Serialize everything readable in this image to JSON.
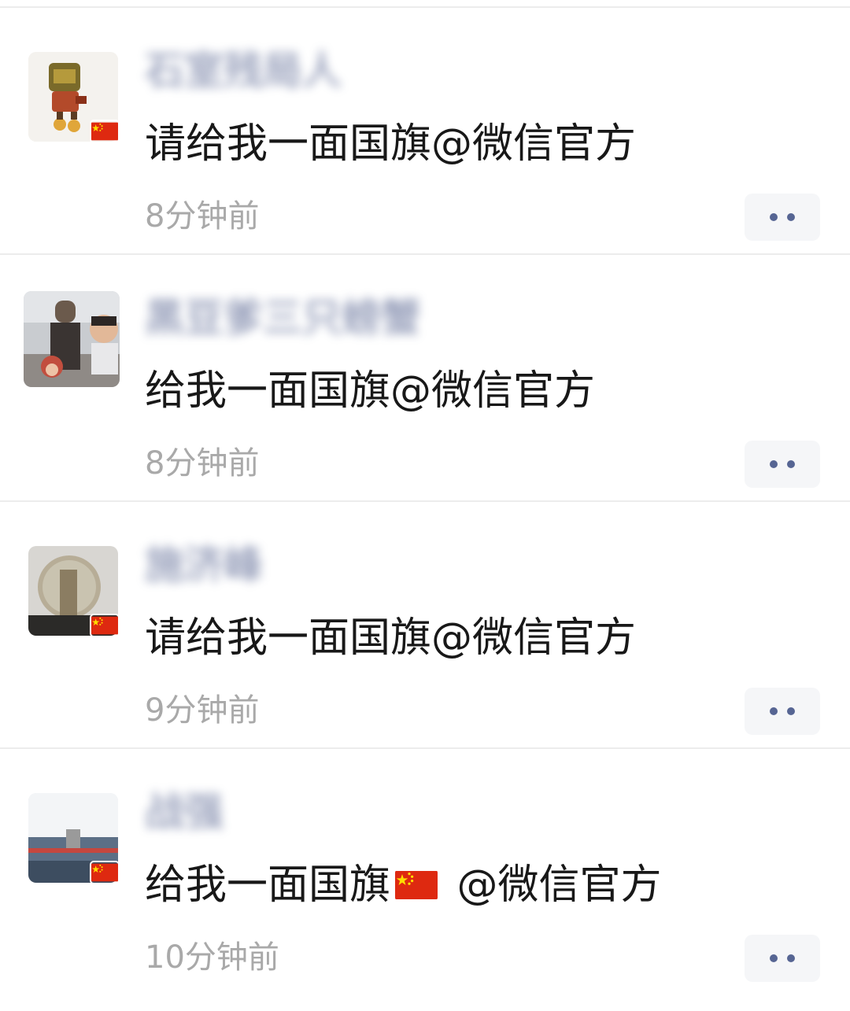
{
  "comments": [
    {
      "username": "石室残局人",
      "text": "请给我一面国旗@微信官方",
      "text_suffix": "",
      "time": "8分钟前",
      "avatar_icon": "cartoon-avatar-icon",
      "has_flag_badge": true
    },
    {
      "username": "黑豆爹三只螃蟹",
      "text": "给我一面国旗@微信官方",
      "text_suffix": "",
      "time": "8分钟前",
      "avatar_icon": "family-photo-avatar-icon",
      "has_flag_badge": false
    },
    {
      "username": "施济峰",
      "text": "请给我一面国旗@微信官方",
      "text_suffix": "",
      "time": "9分钟前",
      "avatar_icon": "round-window-avatar-icon",
      "has_flag_badge": true
    },
    {
      "username": "战强",
      "text": "给我一面国旗",
      "text_suffix": " @微信官方",
      "time": "10分钟前",
      "avatar_icon": "stadium-avatar-icon",
      "has_flag_badge": true
    }
  ],
  "more_icon": "more-dots-icon",
  "flag_icon": "china-flag-icon",
  "colors": {
    "username": "#4d5b8a",
    "timestamp": "#a9a9a9",
    "more_dots": "#566593",
    "flag_red": "#de2910",
    "flag_yellow": "#ffde00"
  }
}
